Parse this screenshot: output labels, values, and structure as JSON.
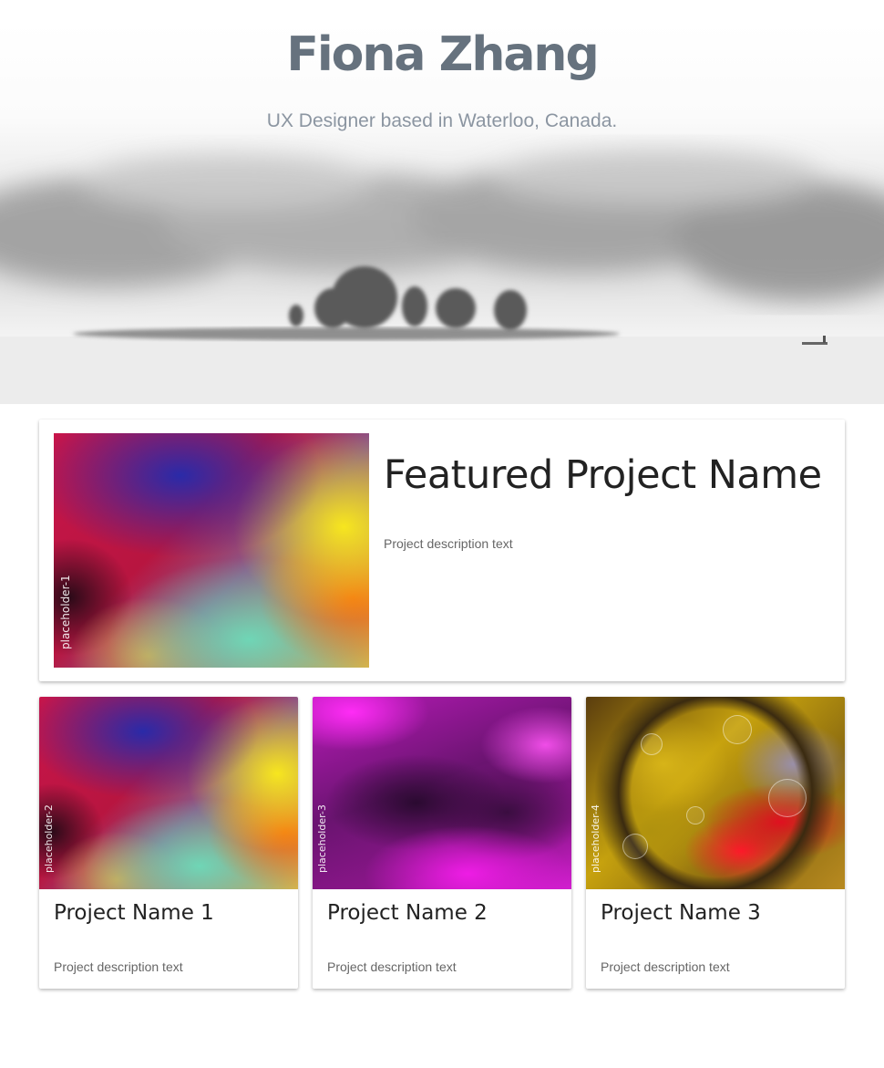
{
  "hero": {
    "title": "Fiona Zhang",
    "subtitle": "UX Designer based in Waterloo, Canada."
  },
  "featured": {
    "image_label": "placeholder-1",
    "title": "Featured Project Name",
    "description": "Project description text"
  },
  "projects": [
    {
      "image_label": "placeholder-2",
      "title": "Project Name 1",
      "description": "Project description text"
    },
    {
      "image_label": "placeholder-3",
      "title": "Project Name 2",
      "description": "Project description text"
    },
    {
      "image_label": "placeholder-4",
      "title": "Project Name 3",
      "description": "Project description text"
    }
  ],
  "colors": {
    "hero_title": "#66727e",
    "hero_subtitle": "#8b95a1",
    "card_title": "#222222",
    "card_text": "#666666"
  }
}
